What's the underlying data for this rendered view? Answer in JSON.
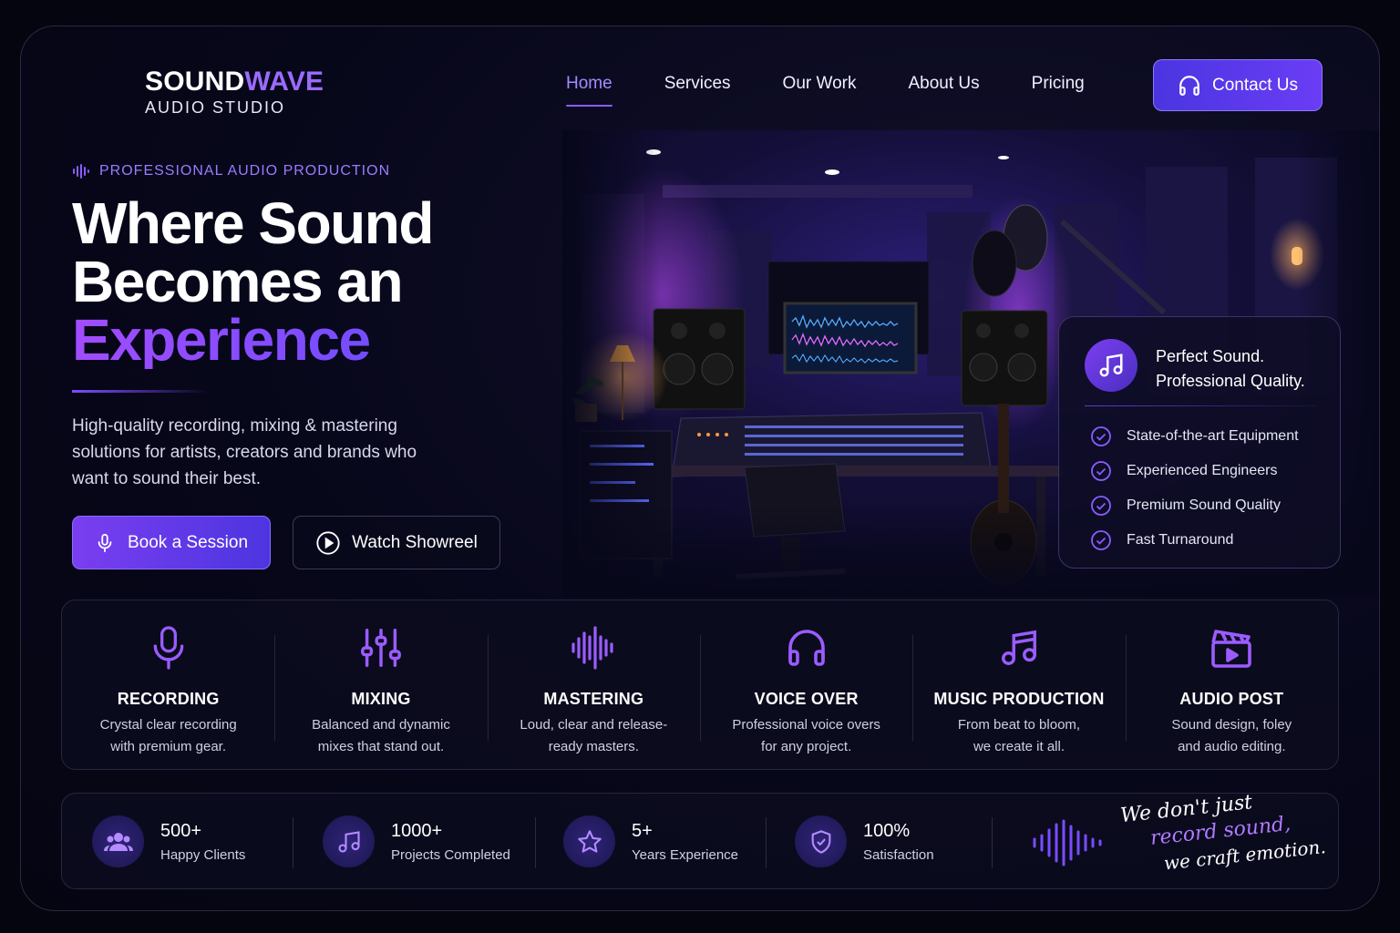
{
  "brand": {
    "name_part1": "SOUND",
    "name_part2": "WAVE",
    "subtitle": "AUDIO STUDIO"
  },
  "nav": {
    "items": [
      {
        "label": "Home",
        "active": true
      },
      {
        "label": "Services"
      },
      {
        "label": "Our Work"
      },
      {
        "label": "About Us"
      },
      {
        "label": "Pricing"
      }
    ],
    "contact_label": "Contact Us"
  },
  "hero": {
    "eyebrow": "PROFESSIONAL AUDIO PRODUCTION",
    "headline_line1": "Where Sound",
    "headline_line2": "Becomes an",
    "headline_accent": "Experience",
    "description": "High-quality recording, mixing & mastering solutions for artists, creators and brands who want to sound their best.",
    "primary_button": "Book a Session",
    "secondary_button": "Watch Showreel"
  },
  "info_card": {
    "title_line1": "Perfect Sound.",
    "title_line2": "Professional Quality.",
    "features": [
      "State-of-the-art Equipment",
      "Experienced Engineers",
      "Premium Sound Quality",
      "Fast Turnaround"
    ]
  },
  "services": [
    {
      "icon": "microphone-icon",
      "title": "RECORDING",
      "desc_line1": "Crystal clear recording",
      "desc_line2": "with premium gear."
    },
    {
      "icon": "sliders-icon",
      "title": "MIXING",
      "desc_line1": "Balanced and dynamic",
      "desc_line2": "mixes that stand out."
    },
    {
      "icon": "waveform-icon",
      "title": "MASTERING",
      "desc_line1": "Loud, clear and release-",
      "desc_line2": "ready masters."
    },
    {
      "icon": "headphones-icon",
      "title": "VOICE OVER",
      "desc_line1": "Professional voice overs",
      "desc_line2": "for any project."
    },
    {
      "icon": "music-note-icon",
      "title": "MUSIC PRODUCTION",
      "desc_line1": "From beat to bloom,",
      "desc_line2": "we create it all."
    },
    {
      "icon": "clapperboard-icon",
      "title": "AUDIO POST",
      "desc_line1": "Sound design, foley",
      "desc_line2": "and audio editing."
    }
  ],
  "stats": [
    {
      "icon": "users-icon",
      "value": "500+",
      "label": "Happy Clients"
    },
    {
      "icon": "music-note-icon",
      "value": "1000+",
      "label": "Projects Completed"
    },
    {
      "icon": "star-icon",
      "value": "5+",
      "label": "Years Experience"
    },
    {
      "icon": "shield-check-icon",
      "value": "100%",
      "label": "Satisfaction"
    }
  ],
  "tagline": {
    "line1": "We don't just",
    "line2": "record sound,",
    "line3": "we craft emotion."
  },
  "colors": {
    "accent": "#8a5cff",
    "accent_dark": "#4c35e0",
    "background": "#07071a"
  }
}
